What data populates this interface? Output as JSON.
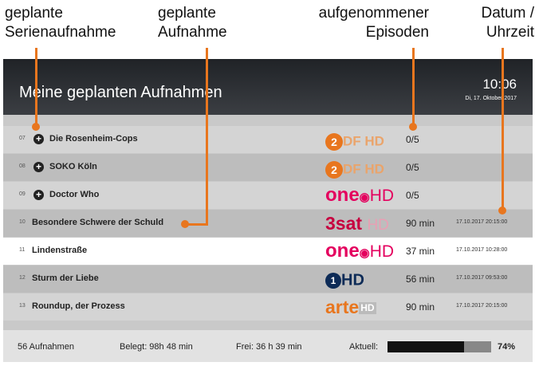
{
  "annotations": {
    "series": "geplante\nSerienaufnahme",
    "recording": "geplante\nAufnahme",
    "episodes": "aufgenommener\nEpisoden",
    "datetime": "Datum /\nUhrzeit"
  },
  "header": {
    "title": "Meine geplanten Aufnahmen",
    "time": "10:06",
    "date": "Di, 17. Oktober 2017"
  },
  "rows": [
    {
      "num": "07",
      "series": true,
      "name": "Die Rosenheim-Cops",
      "channel": "zdf",
      "info": "0/5",
      "datetime": ""
    },
    {
      "num": "08",
      "series": true,
      "name": "SOKO Köln",
      "channel": "zdf",
      "info": "0/5",
      "datetime": ""
    },
    {
      "num": "09",
      "series": true,
      "name": "Doctor Who",
      "channel": "one",
      "info": "0/5",
      "datetime": ""
    },
    {
      "num": "10",
      "series": false,
      "name": "Besondere Schwere der Schuld",
      "channel": "3sat",
      "info": "90 min",
      "datetime": "17.10.2017 20:15:00"
    },
    {
      "num": "11",
      "series": false,
      "name": "Lindenstraße",
      "channel": "one",
      "info": "37 min",
      "datetime": "17.10.2017 10:28:00"
    },
    {
      "num": "12",
      "series": false,
      "name": "Sturm der Liebe",
      "channel": "ard",
      "info": "56 min",
      "datetime": "17.10.2017 09:53:00"
    },
    {
      "num": "13",
      "series": false,
      "name": "Roundup, der Prozess",
      "channel": "arte",
      "info": "90 min",
      "datetime": "17.10.2017 20:15:00"
    }
  ],
  "footer": {
    "count": "56 Aufnahmen",
    "used": "Belegt: 98h 48 min",
    "free": "Frei: 36 h 39 min",
    "current_label": "Aktuell:",
    "current_value": "74%",
    "current_fraction": 0.74
  },
  "colors": {
    "accent": "#e8761e",
    "one": "#e4005e",
    "selected_row": "#ffffff"
  }
}
